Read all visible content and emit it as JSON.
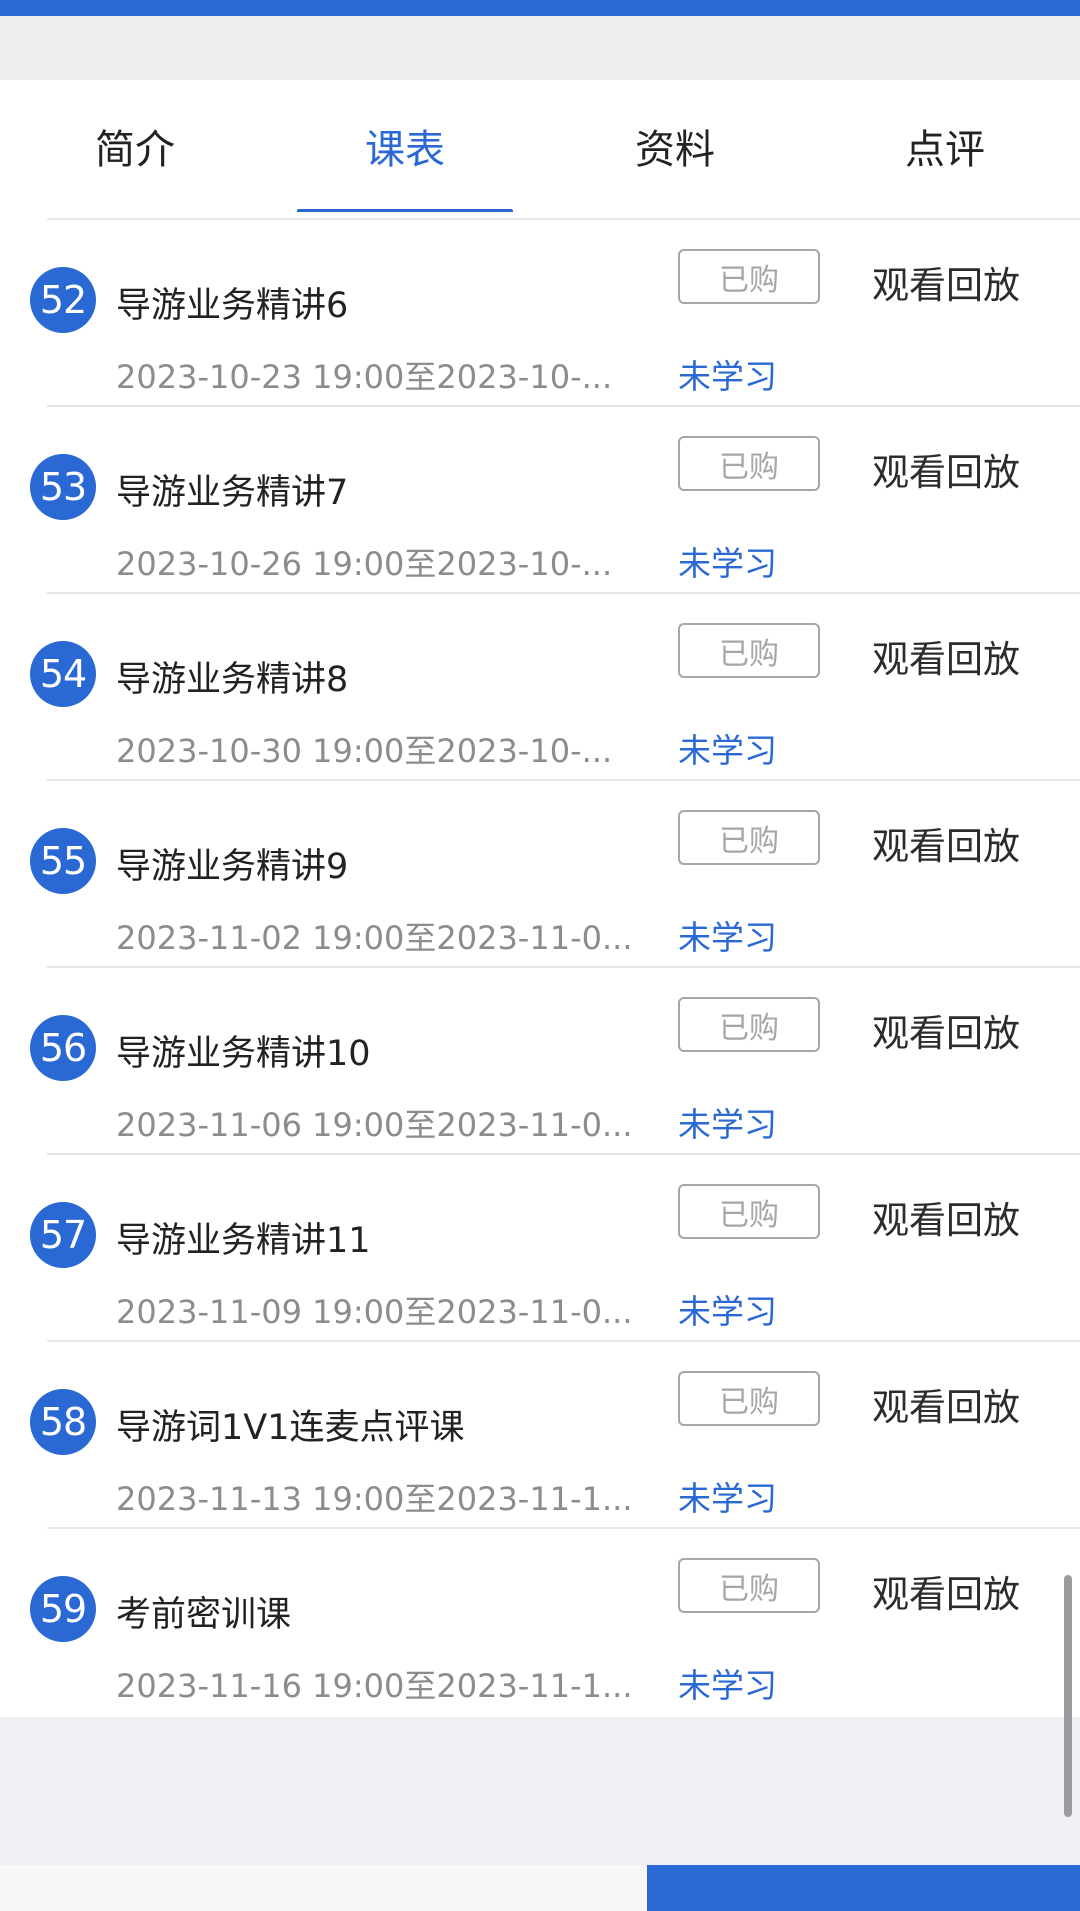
{
  "colors": {
    "accent": "#2a68d4",
    "badge": "#2a68d4",
    "status": "#2a68d4",
    "muted": "#8c8c90"
  },
  "tabs": [
    {
      "label": "简介"
    },
    {
      "label": "课表"
    },
    {
      "label": "资料"
    },
    {
      "label": "点评"
    }
  ],
  "active_tab": "课表",
  "lessons": [
    {
      "num": "52",
      "title": "导游业务精讲6",
      "time": "2023-10-23 19:00至2023-10-...",
      "status": "未学习",
      "bought": "已购",
      "action": "观看回放"
    },
    {
      "num": "53",
      "title": "导游业务精讲7",
      "time": "2023-10-26 19:00至2023-10-...",
      "status": "未学习",
      "bought": "已购",
      "action": "观看回放"
    },
    {
      "num": "54",
      "title": "导游业务精讲8",
      "time": "2023-10-30 19:00至2023-10-...",
      "status": "未学习",
      "bought": "已购",
      "action": "观看回放"
    },
    {
      "num": "55",
      "title": "导游业务精讲9",
      "time": "2023-11-02 19:00至2023-11-0...",
      "status": "未学习",
      "bought": "已购",
      "action": "观看回放"
    },
    {
      "num": "56",
      "title": "导游业务精讲10",
      "time": "2023-11-06 19:00至2023-11-0...",
      "status": "未学习",
      "bought": "已购",
      "action": "观看回放"
    },
    {
      "num": "57",
      "title": "导游业务精讲11",
      "time": "2023-11-09 19:00至2023-11-0...",
      "status": "未学习",
      "bought": "已购",
      "action": "观看回放"
    },
    {
      "num": "58",
      "title": "导游词1V1连麦点评课",
      "time": "2023-11-13 19:00至2023-11-1...",
      "status": "未学习",
      "bought": "已购",
      "action": "观看回放"
    },
    {
      "num": "59",
      "title": "考前密训课",
      "time": "2023-11-16 19:00至2023-11-1...",
      "status": "未学习",
      "bought": "已购",
      "action": "观看回放"
    }
  ]
}
